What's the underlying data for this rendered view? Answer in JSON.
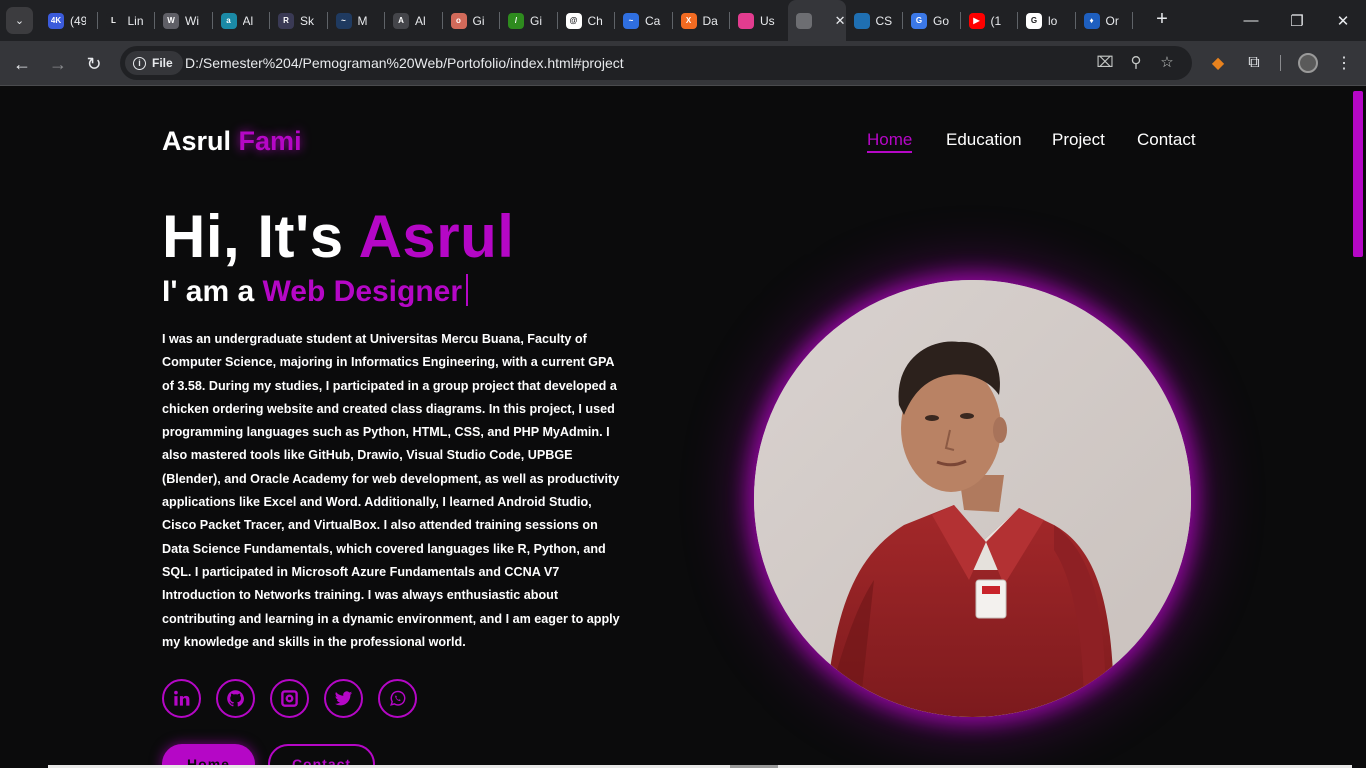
{
  "browser": {
    "tabs": [
      {
        "title": "(49",
        "favicon": "youtube-4k-icon",
        "color": "#3b5bdb",
        "glyph": "4K"
      },
      {
        "title": "Lin",
        "favicon": "linkedin-icon",
        "color": "#202124",
        "glyph": "L"
      },
      {
        "title": "Wi",
        "favicon": "wikipedia-icon",
        "color": "#5f5f66",
        "glyph": "W"
      },
      {
        "title": "Al",
        "favicon": "ai-tool-icon",
        "color": "#1b8aa6",
        "glyph": "a"
      },
      {
        "title": "Sk",
        "favicon": "sk-icon",
        "color": "#3a3a55",
        "glyph": "R"
      },
      {
        "title": "M",
        "favicon": "m-icon",
        "color": "#1f3a60",
        "glyph": "~"
      },
      {
        "title": "Al",
        "favicon": "triangle-icon",
        "color": "#44454a",
        "glyph": "A"
      },
      {
        "title": "Gi",
        "favicon": "onion-icon",
        "color": "#d26a5a",
        "glyph": "o"
      },
      {
        "title": "Gi",
        "favicon": "leaf-icon",
        "color": "#2e8b1e",
        "glyph": "/"
      },
      {
        "title": "Ch",
        "favicon": "openai-icon",
        "color": "#ffffff",
        "glyph": "@"
      },
      {
        "title": "Ca",
        "favicon": "canva-icon",
        "color": "#2f6fe0",
        "glyph": "~"
      },
      {
        "title": "Da",
        "favicon": "xampp-icon",
        "color": "#f26b22",
        "glyph": "X"
      },
      {
        "title": "Us",
        "favicon": "cube-icon",
        "color": "#e23c8f",
        "glyph": ""
      },
      {
        "title": "",
        "favicon": "globe-icon",
        "color": "#6d6e72",
        "glyph": "",
        "active": true
      },
      {
        "title": "CS",
        "favicon": "cs-icon",
        "color": "#1f6fb2",
        "glyph": ""
      },
      {
        "title": "Go",
        "favicon": "google-translate-icon",
        "color": "#3b78e7",
        "glyph": "G"
      },
      {
        "title": "(1",
        "favicon": "youtube-icon",
        "color": "#ff0000",
        "glyph": "▶"
      },
      {
        "title": "lo",
        "favicon": "google-icon",
        "color": "#ffffff",
        "glyph": "G"
      },
      {
        "title": "Or",
        "favicon": "flame-icon",
        "color": "#1e5fbf",
        "glyph": "♦"
      }
    ],
    "url_scheme_label": "File",
    "url": "D:/Semester%204/Pemograman%20Web/Portofolio/index.html#project"
  },
  "site": {
    "logo_first": "Asrul",
    "logo_second": "Fami",
    "nav": [
      "Home",
      "Education",
      "Project",
      "Contact"
    ],
    "nav_current": "Home",
    "greeting": "Hi, It's",
    "greeting_name": "Asrul",
    "role_prefix": "I' am a",
    "role": "Web Designer",
    "bio": "I was an undergraduate student at Universitas Mercu Buana, Faculty of Computer Science, majoring in Informatics Engineering, with a current GPA of 3.58. During my studies, I participated in a group project that developed a chicken ordering website and created class diagrams. In this project, I used programming languages such as Python, HTML, CSS, and PHP MyAdmin. I also mastered tools like GitHub, Drawio, Visual Studio Code, UPBGE (Blender), and Oracle Academy for web development, as well as productivity applications like Excel and Word. Additionally, I learned Android Studio, Cisco Packet Tracer, and VirtualBox. I also attended training sessions on Data Science Fundamentals, which covered languages like R, Python, and SQL. I participated in Microsoft Azure Fundamentals and CCNA V7 Introduction to Networks training. I was always enthusiastic about contributing and learning in a dynamic environment, and I am eager to apply my knowledge and skills in the professional world.",
    "socials": [
      "linkedin-icon",
      "github-icon",
      "instagram-icon",
      "twitter-icon",
      "whatsapp-icon"
    ],
    "buttons": {
      "primary": "Home",
      "secondary": "Contact"
    },
    "accent_color": "#b507c6"
  }
}
